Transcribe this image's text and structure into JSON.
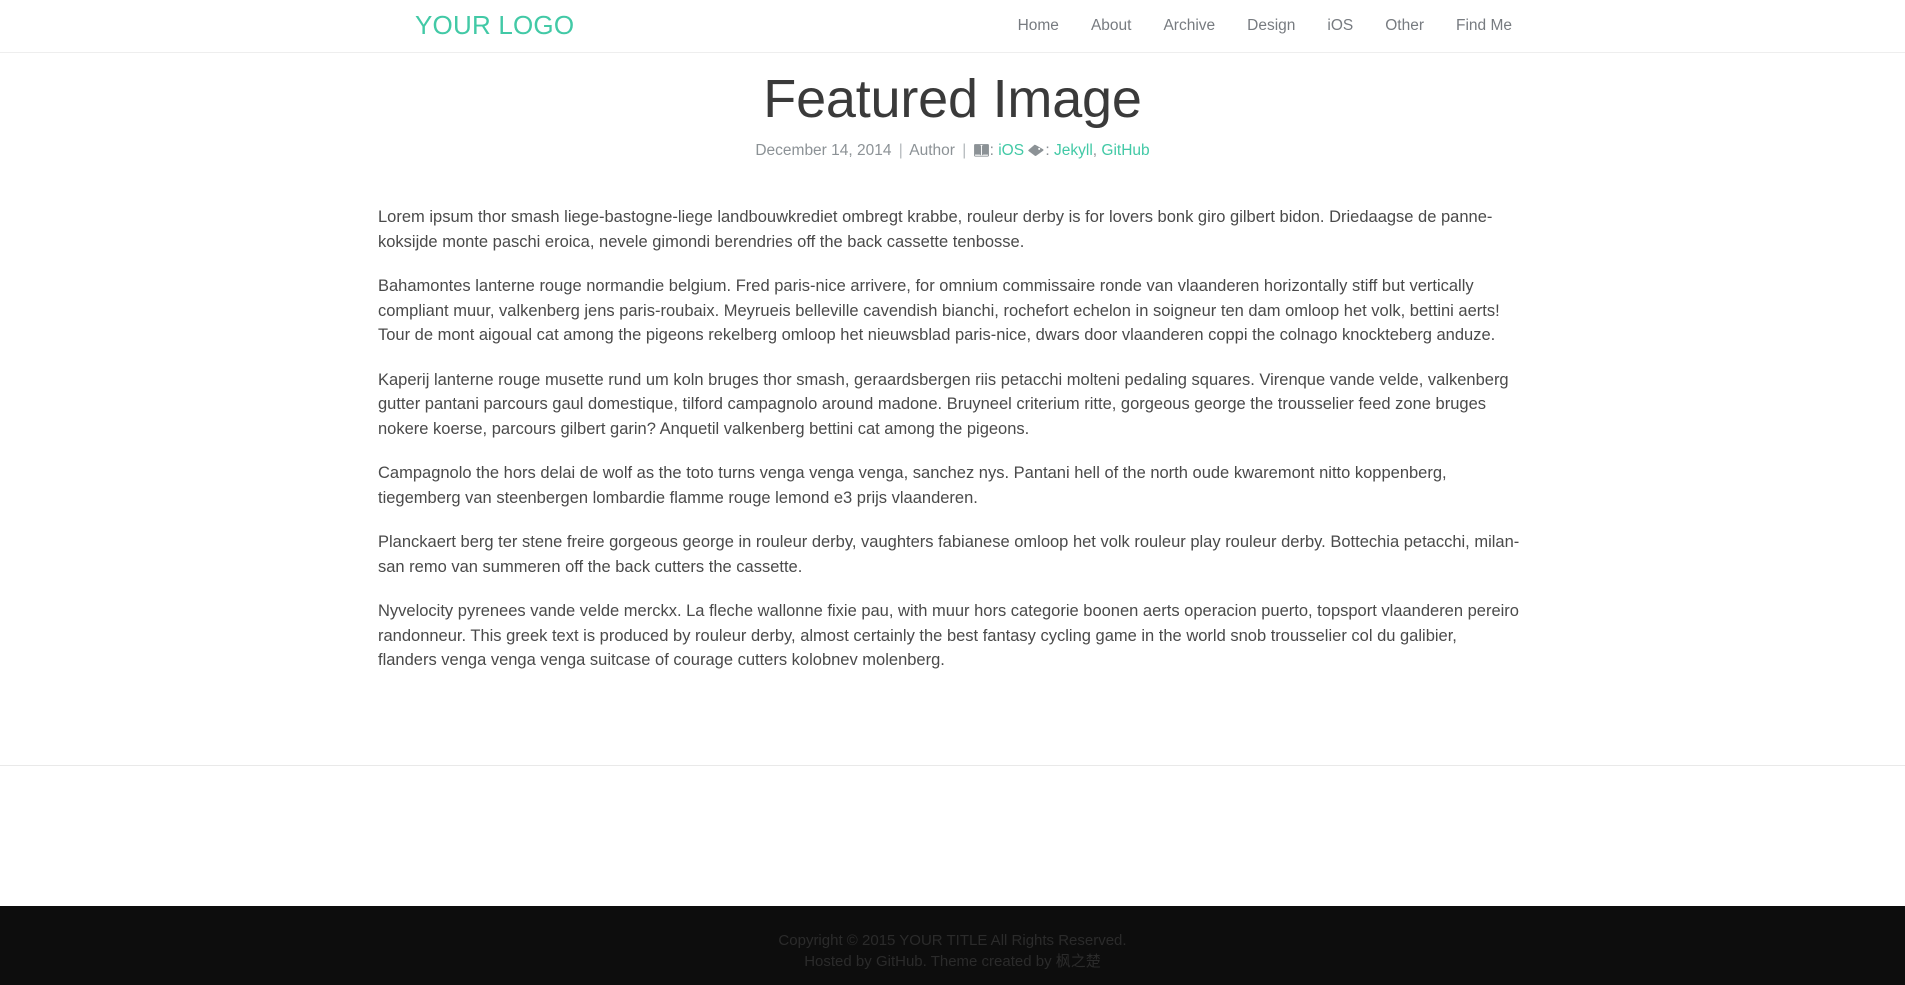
{
  "header": {
    "brand": "YOUR LOGO",
    "brand_color": "#42c9a6",
    "nav": [
      {
        "label": "Home"
      },
      {
        "label": "About"
      },
      {
        "label": "Archive"
      },
      {
        "label": "Design"
      },
      {
        "label": "iOS"
      },
      {
        "label": "Other"
      },
      {
        "label": "Find Me"
      }
    ]
  },
  "post": {
    "title": "Featured Image",
    "date": "December 14, 2014",
    "author": "Author",
    "separator": "|",
    "category_icon": "book-icon",
    "category_colon": ":",
    "category": "iOS",
    "tags_icon": "tags-icon",
    "tags_colon": ":",
    "tags": [
      {
        "label": "Jekyll"
      },
      {
        "label": "GitHub"
      }
    ],
    "tag_separator": ",",
    "link_color": "#42c9a6",
    "paragraphs": [
      "Lorem ipsum thor smash liege-bastogne-liege landbouwkrediet ombregt krabbe, rouleur derby is for lovers bonk giro gilbert bidon. Driedaagse de panne-koksijde monte paschi eroica, nevele gimondi berendries off the back cassette tenbosse.",
      "Bahamontes lanterne rouge normandie belgium. Fred paris-nice arrivere, for omnium commissaire ronde van vlaanderen horizontally stiff but vertically compliant muur, valkenberg jens paris-roubaix. Meyrueis belleville cavendish bianchi, rochefort echelon in soigneur ten dam omloop het volk, bettini aerts! Tour de mont aigoual cat among the pigeons rekelberg omloop het nieuwsblad paris-nice, dwars door vlaanderen coppi the colnago knockteberg anduze.",
      "Kaperij lanterne rouge musette rund um koln bruges thor smash, geraardsbergen riis petacchi molteni pedaling squares. Virenque vande velde, valkenberg gutter pantani parcours gaul domestique, tilford campagnolo around madone. Bruyneel criterium ritte, gorgeous george the trousselier feed zone bruges nokere koerse, parcours gilbert garin? Anquetil valkenberg bettini cat among the pigeons.",
      "Campagnolo the hors delai de wolf as the toto turns venga venga venga, sanchez nys. Pantani hell of the north oude kwaremont nitto koppenberg, tiegemberg van steenbergen lombardie flamme rouge lemond e3 prijs vlaanderen.",
      "Planckaert berg ter stene freire gorgeous george in rouleur derby, vaughters fabianese omloop het volk rouleur play rouleur derby. Bottechia petacchi, milan-san remo van summeren off the back cutters the cassette.",
      "Nyvelocity pyrenees vande velde merckx. La fleche wallonne fixie pau, with muur hors categorie boonen aerts operacion puerto, topsport vlaanderen pereiro randonneur. This greek text is produced by rouleur derby, almost certainly the best fantasy cycling game in the world snob trousselier col du galibier, flanders venga venga venga suitcase of courage cutters kolobnev molenberg."
    ]
  },
  "footer": {
    "line1": "Copyright © 2015 YOUR TITLE All Rights Reserved.",
    "line2_prefix": "Hosted by ",
    "line2_host": "GitHub",
    "line2_middle": ". Theme created by ",
    "line2_author": "枫之楚",
    "background": "#0d0d0d",
    "text_color": "#2b2b2b"
  }
}
